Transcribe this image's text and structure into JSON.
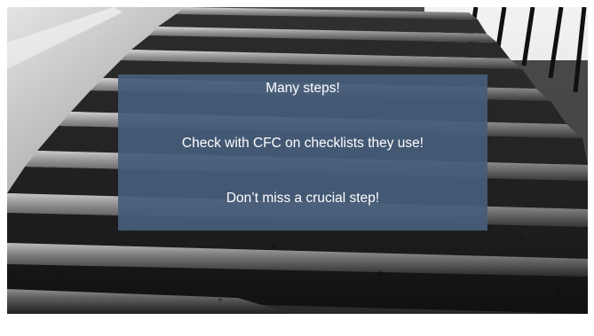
{
  "slide": {
    "image_subject": "stone-staircase",
    "caption": {
      "line1": "Many steps!",
      "line2": "Check with CFC on checklists they use!",
      "line3": "Don’t miss a crucial step!"
    },
    "colors": {
      "caption_background": "#465c7a",
      "caption_text": "#ffffff",
      "slide_background": "#ffffff"
    }
  }
}
